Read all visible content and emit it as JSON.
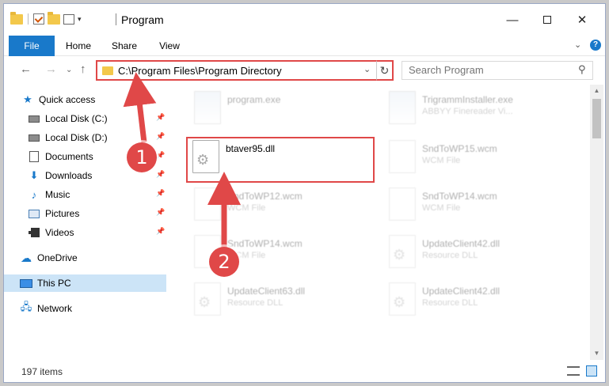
{
  "window": {
    "title": "Program"
  },
  "ribbon": {
    "file": "File",
    "home": "Home",
    "share": "Share",
    "view": "View",
    "help": "?"
  },
  "nav": {
    "address": "C:\\Program Files\\Program Directory",
    "search_placeholder": "Search Program"
  },
  "sidebar": {
    "items": [
      {
        "label": "Quick access",
        "icon": "star-icon"
      },
      {
        "label": "Local Disk (C:)",
        "icon": "disk-icon",
        "pinned": true
      },
      {
        "label": "Local Disk (D:)",
        "icon": "disk-icon",
        "pinned": true
      },
      {
        "label": "Documents",
        "icon": "document-icon",
        "pinned": true
      },
      {
        "label": "Downloads",
        "icon": "download-icon",
        "pinned": true
      },
      {
        "label": "Music",
        "icon": "music-icon",
        "pinned": true
      },
      {
        "label": "Pictures",
        "icon": "pictures-icon",
        "pinned": true
      },
      {
        "label": "Videos",
        "icon": "videos-icon",
        "pinned": true
      },
      {
        "label": "OneDrive",
        "icon": "cloud-icon"
      },
      {
        "label": "This PC",
        "icon": "computer-icon",
        "selected": true
      },
      {
        "label": "Network",
        "icon": "network-icon"
      }
    ]
  },
  "files": [
    {
      "name": "program.exe",
      "type": ""
    },
    {
      "name": "TrigrammInstaller.exe",
      "type": "ABBYY Finereader Vi..."
    },
    {
      "name": "btaver95.dll",
      "type": ""
    },
    {
      "name": "SndToWP15.wcm",
      "type": "WCM File"
    },
    {
      "name": "SndToWP12.wcm",
      "type": "WCM File"
    },
    {
      "name": "SndToWP14.wcm",
      "type": "WCM File"
    },
    {
      "name": "SndToWP14.wcm",
      "type": "WCM File"
    },
    {
      "name": "UpdateClient42.dll",
      "type": "Resource DLL"
    },
    {
      "name": "UpdateClient63.dll",
      "type": "Resource DLL"
    },
    {
      "name": "UpdateClient42.dll",
      "type": "Resource DLL"
    }
  ],
  "status": {
    "count": "197 items"
  },
  "annotations": {
    "step1": "1",
    "step2": "2",
    "accent": "#e04848"
  }
}
